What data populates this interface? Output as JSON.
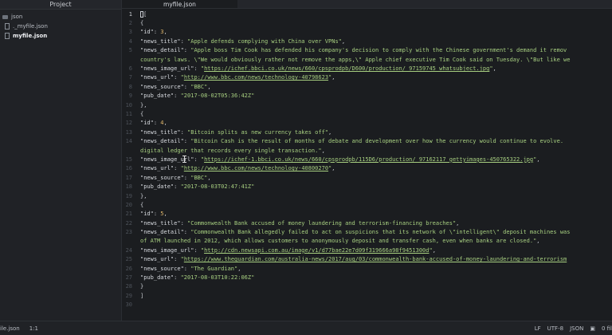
{
  "sidebar": {
    "header": "Project",
    "items": [
      {
        "label": "json",
        "type": "folder"
      },
      {
        "label": "._myfile.json",
        "type": "file"
      },
      {
        "label": "myfile.json",
        "type": "file",
        "active": true
      }
    ]
  },
  "tabs": [
    {
      "label": "myfile.json"
    }
  ],
  "editor": {
    "lines": [
      [
        {
          "t": "[",
          "c": "p"
        }
      ],
      [
        {
          "t": "{",
          "c": "p"
        }
      ],
      [
        {
          "t": "\"id\"",
          "c": "k"
        },
        {
          "t": ": ",
          "c": "p"
        },
        {
          "t": "3",
          "c": "n"
        },
        {
          "t": ",",
          "c": "p"
        }
      ],
      [
        {
          "t": "\"news_title\"",
          "c": "k"
        },
        {
          "t": ": ",
          "c": "p"
        },
        {
          "t": "\"Apple defends complying with China over VPNs\"",
          "c": "s"
        },
        {
          "t": ",",
          "c": "p"
        }
      ],
      [
        {
          "t": "\"news_detail\"",
          "c": "k"
        },
        {
          "t": ": ",
          "c": "p"
        },
        {
          "t": "\"Apple boss Tim Cook has defended his company's decision to comply with the Chinese government's demand it remov",
          "c": "s"
        }
      ],
      [
        {
          "t": "country's laws. \\\"We would obviously rather not remove the apps,\\\" Apple chief executive Tim Cook said on Tuesday. \\\"But like we",
          "c": "s"
        }
      ],
      [
        {
          "t": "\"news_image_url\"",
          "c": "k"
        },
        {
          "t": ": ",
          "c": "p"
        },
        {
          "t": "\"",
          "c": "s"
        },
        {
          "t": "https://ichef.bbci.co.uk/news/660/cpsprodpb/D600/production/_97159745_whatsubject.jpg",
          "c": "u"
        },
        {
          "t": "\"",
          "c": "s"
        },
        {
          "t": ",",
          "c": "p"
        }
      ],
      [
        {
          "t": "\"news_url\"",
          "c": "k"
        },
        {
          "t": ": ",
          "c": "p"
        },
        {
          "t": "\"",
          "c": "s"
        },
        {
          "t": "http://www.bbc.com/news/technology-40798623",
          "c": "u"
        },
        {
          "t": "\"",
          "c": "s"
        },
        {
          "t": ",",
          "c": "p"
        }
      ],
      [
        {
          "t": "\"news_source\"",
          "c": "k"
        },
        {
          "t": ": ",
          "c": "p"
        },
        {
          "t": "\"BBC\"",
          "c": "s"
        },
        {
          "t": ",",
          "c": "p"
        }
      ],
      [
        {
          "t": "\"pub_date\"",
          "c": "k"
        },
        {
          "t": ": ",
          "c": "p"
        },
        {
          "t": "\"2017-08-02T05:36:42Z\"",
          "c": "s"
        }
      ],
      [
        {
          "t": "},",
          "c": "p"
        }
      ],
      [
        {
          "t": "{",
          "c": "p"
        }
      ],
      [
        {
          "t": "\"id\"",
          "c": "k"
        },
        {
          "t": ": ",
          "c": "p"
        },
        {
          "t": "4",
          "c": "n"
        },
        {
          "t": ",",
          "c": "p"
        }
      ],
      [
        {
          "t": "\"news_title\"",
          "c": "k"
        },
        {
          "t": ": ",
          "c": "p"
        },
        {
          "t": "\"Bitcoin splits as new currency takes off\"",
          "c": "s"
        },
        {
          "t": ",",
          "c": "p"
        }
      ],
      [
        {
          "t": "\"news_detail\"",
          "c": "k"
        },
        {
          "t": ": ",
          "c": "p"
        },
        {
          "t": "\"Bitcoin Cash is the result of months of debate and development over how the currency would continue to evolve.",
          "c": "s"
        }
      ],
      [
        {
          "t": "digital ledger that records every single transaction.\"",
          "c": "s"
        },
        {
          "t": ",",
          "c": "p"
        }
      ],
      [
        {
          "t": "\"news_image_url\"",
          "c": "k"
        },
        {
          "t": ": ",
          "c": "p"
        },
        {
          "t": "\"",
          "c": "s"
        },
        {
          "t": "https://ichef-1.bbci.co.uk/news/660/cpsprodpb/115D6/production/_97162117_gettyimages-450765322.jpg",
          "c": "u"
        },
        {
          "t": "\"",
          "c": "s"
        },
        {
          "t": ",",
          "c": "p"
        }
      ],
      [
        {
          "t": "\"news_url\"",
          "c": "k"
        },
        {
          "t": ": ",
          "c": "p"
        },
        {
          "t": "\"",
          "c": "s"
        },
        {
          "t": "http://www.bbc.com/news/technology-40800270",
          "c": "u"
        },
        {
          "t": "\"",
          "c": "s"
        },
        {
          "t": ",",
          "c": "p"
        }
      ],
      [
        {
          "t": "\"news_source\"",
          "c": "k"
        },
        {
          "t": ": ",
          "c": "p"
        },
        {
          "t": "\"BBC\"",
          "c": "s"
        },
        {
          "t": ",",
          "c": "p"
        }
      ],
      [
        {
          "t": "\"pub_date\"",
          "c": "k"
        },
        {
          "t": ": ",
          "c": "p"
        },
        {
          "t": "\"2017-08-03T02:47:41Z\"",
          "c": "s"
        }
      ],
      [
        {
          "t": "},",
          "c": "p"
        }
      ],
      [
        {
          "t": "{",
          "c": "p"
        }
      ],
      [
        {
          "t": "\"id\"",
          "c": "k"
        },
        {
          "t": ": ",
          "c": "p"
        },
        {
          "t": "5",
          "c": "n"
        },
        {
          "t": ",",
          "c": "p"
        }
      ],
      [
        {
          "t": "\"news_title\"",
          "c": "k"
        },
        {
          "t": ": ",
          "c": "p"
        },
        {
          "t": "\"Commonwealth Bank accused of money laundering and terrorism-financing breaches\"",
          "c": "s"
        },
        {
          "t": ",",
          "c": "p"
        }
      ],
      [
        {
          "t": "\"news_detail\"",
          "c": "k"
        },
        {
          "t": ": ",
          "c": "p"
        },
        {
          "t": "\"Commonwealth Bank allegedly failed to act on suspicions that its network of \\\"intelligent\\\" deposit machines was",
          "c": "s"
        }
      ],
      [
        {
          "t": "of ATM launched in 2012, which allows customers to anonymously deposit and transfer cash, even when banks are closed.\"",
          "c": "s"
        },
        {
          "t": ",",
          "c": "p"
        }
      ],
      [
        {
          "t": "\"news_image_url\"",
          "c": "k"
        },
        {
          "t": ": ",
          "c": "p"
        },
        {
          "t": "\"",
          "c": "s"
        },
        {
          "t": "http://cdn.newsapi.com.au/image/v1/d77bae22e7d09f319666a98f9451300d",
          "c": "u"
        },
        {
          "t": "\"",
          "c": "s"
        },
        {
          "t": ",",
          "c": "p"
        }
      ],
      [
        {
          "t": "\"news_url\"",
          "c": "k"
        },
        {
          "t": ": ",
          "c": "p"
        },
        {
          "t": "\"",
          "c": "s"
        },
        {
          "t": "https://www.theguardian.com/australia-news/2017/aug/03/commonwealth-bank-accused-of-money-laundering-and-terrorism",
          "c": "u"
        }
      ],
      [
        {
          "t": "\"news_source\"",
          "c": "k"
        },
        {
          "t": ": ",
          "c": "p"
        },
        {
          "t": "\"The Guardian\"",
          "c": "s"
        },
        {
          "t": ",",
          "c": "p"
        }
      ],
      [
        {
          "t": "\"pub_date\"",
          "c": "k"
        },
        {
          "t": ": ",
          "c": "p"
        },
        {
          "t": "\"2017-08-03T10:22:06Z\"",
          "c": "s"
        }
      ],
      [
        {
          "t": "}",
          "c": "p"
        }
      ],
      [
        {
          "t": "]",
          "c": "p"
        }
      ],
      []
    ],
    "gutter": [
      "1",
      "2",
      "3",
      "4",
      "5",
      "",
      "6",
      "7",
      "8",
      "9",
      "10",
      "11",
      "12",
      "13",
      "14",
      "",
      "15",
      "16",
      "17",
      "18",
      "19",
      "20",
      "21",
      "22",
      "23",
      "",
      "24",
      "25",
      "26",
      "27",
      "28",
      "29",
      "30"
    ],
    "indent": [
      0,
      1,
      2,
      2,
      2,
      2,
      2,
      2,
      2,
      2,
      1,
      1,
      2,
      2,
      2,
      2,
      2,
      2,
      2,
      2,
      1,
      1,
      2,
      2,
      2,
      2,
      2,
      2,
      2,
      2,
      1,
      0,
      0
    ]
  },
  "status": {
    "file": "ile.json",
    "position": "1:1",
    "line_ending": "LF",
    "encoding": "UTF-8",
    "grammar": "JSON",
    "git": "0 fil"
  }
}
